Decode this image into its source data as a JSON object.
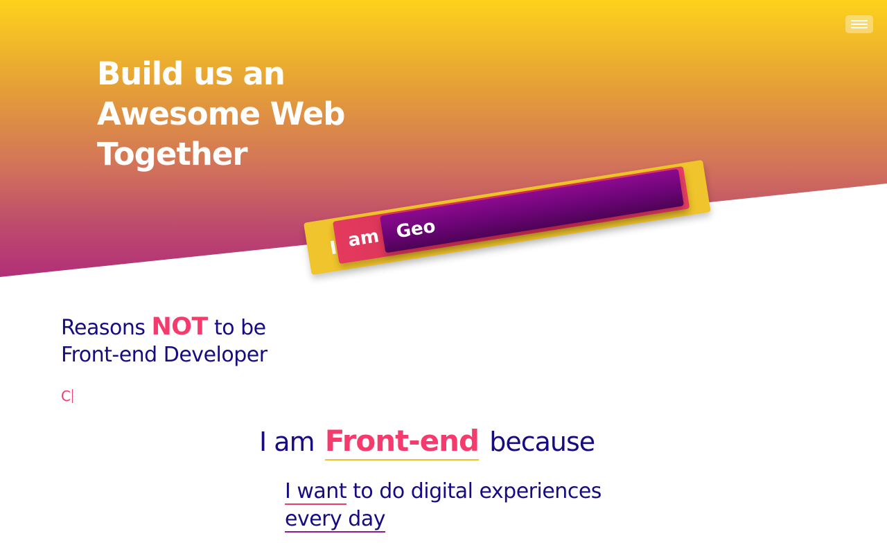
{
  "hero": {
    "title_lines": [
      "Build us an",
      "Awesome Web",
      "Together"
    ]
  },
  "nav": {
    "menu_icon": "hamburger-menu-icon"
  },
  "role_cards": [
    {
      "text": "I",
      "color": "#f0c42c"
    },
    {
      "text": "am F",
      "color": "#e33a5d"
    },
    {
      "text": "Geo",
      "color": "#8c0a8e"
    }
  ],
  "reasons": {
    "prefix": "Reasons",
    "accent": "NOT",
    "suffix": "to be",
    "line2": "Front-end Developer",
    "typing_text": "C"
  },
  "iam": {
    "prefix": "I am",
    "role": "Front-end",
    "suffix": "because"
  },
  "reason": {
    "highlight": "I want",
    "rest": "to do digital experiences",
    "line2": "every day"
  },
  "colors": {
    "navy": "#160c80",
    "pink": "#f53b6d",
    "yellow": "#f0c42c",
    "purple": "#8c0a8e"
  }
}
